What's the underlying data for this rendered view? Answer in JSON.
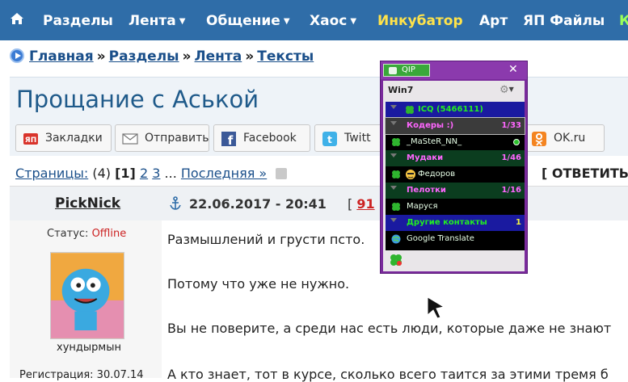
{
  "nav": {
    "items": [
      {
        "label": "Разделы",
        "dropdown": false,
        "highlight": false
      },
      {
        "label": "Лента",
        "dropdown": true,
        "highlight": false
      },
      {
        "label": "Общение",
        "dropdown": true,
        "highlight": false
      },
      {
        "label": "Хаос",
        "dropdown": true,
        "highlight": false
      },
      {
        "label": "Инкубатор",
        "dropdown": false,
        "highlight": true
      },
      {
        "label": "Арт",
        "dropdown": false,
        "highlight": false
      },
      {
        "label": "ЯП Файлы",
        "dropdown": false,
        "highlight": false
      }
    ],
    "overflow_label": "К",
    "home_icon": "home-icon",
    "caret": "▼"
  },
  "breadcrumb": {
    "items": [
      "Главная",
      "Разделы",
      "Лента",
      "Тексты"
    ],
    "separator": "»"
  },
  "topic": {
    "title": "Прощание с Аськой"
  },
  "share": {
    "buttons": [
      {
        "label": "Закладки",
        "icon": "yap-bookmarks-icon"
      },
      {
        "label": "Отправить",
        "icon": "envelope-icon"
      },
      {
        "label": "Facebook",
        "icon": "facebook-icon"
      },
      {
        "label": "Twitt",
        "icon": "twitter-icon"
      },
      {
        "label": "OK.ru",
        "icon": "odnoklassniki-icon"
      }
    ]
  },
  "pager": {
    "label": "Страницы:",
    "count": "(4)",
    "current": "[1]",
    "pages": [
      "2",
      "3"
    ],
    "ellipsis": "...",
    "last": "Последняя »",
    "reply": "[ ОТВЕТИТЬ"
  },
  "post": {
    "author": "PickNick",
    "status_label": "Статус:",
    "status_value": "Offline",
    "avatar_caption": "хундырмын",
    "registration": "Регистрация: 30.07.14",
    "date": "22.06.2017 - 20:41",
    "number_prefix": "[",
    "number": "91",
    "paragraphs": [
      "Размышлений и грусти псто.",
      "Потому что уже не нужно.",
      "Вы не поверите, а среди нас есть люди, которые даже не знают",
      "А кто знает, тот в курсе, сколько всего таится за этими тремя б"
    ]
  },
  "qip": {
    "button": "QIP",
    "close": "✕",
    "account": "Win7",
    "rows": [
      {
        "kind": "account",
        "label": "ICQ (5466111)",
        "count": ""
      },
      {
        "kind": "group",
        "label": "Кодеры :)",
        "count": "1/33"
      },
      {
        "kind": "contact",
        "label": "_MaSteR_NN_",
        "count": ""
      },
      {
        "kind": "group",
        "label": "Мудаки",
        "count": "1/46"
      },
      {
        "kind": "contact",
        "label": "Федоров",
        "count": ""
      },
      {
        "kind": "group",
        "label": "Пелотки",
        "count": "1/16"
      },
      {
        "kind": "contact",
        "label": "Маруся",
        "count": ""
      },
      {
        "kind": "group",
        "label": "Другие контакты",
        "count": "1"
      },
      {
        "kind": "contact",
        "label": "Google Translate",
        "count": ""
      }
    ],
    "colors": {
      "frame": "#7a2a9c",
      "account_row": "#1a1aa0",
      "group_row": "#0b3d1f",
      "selected_group": "#3b3b3b",
      "group_text": "#ff66ff",
      "account_text": "#22ee22",
      "contact_text": "#e8ffe8"
    }
  }
}
